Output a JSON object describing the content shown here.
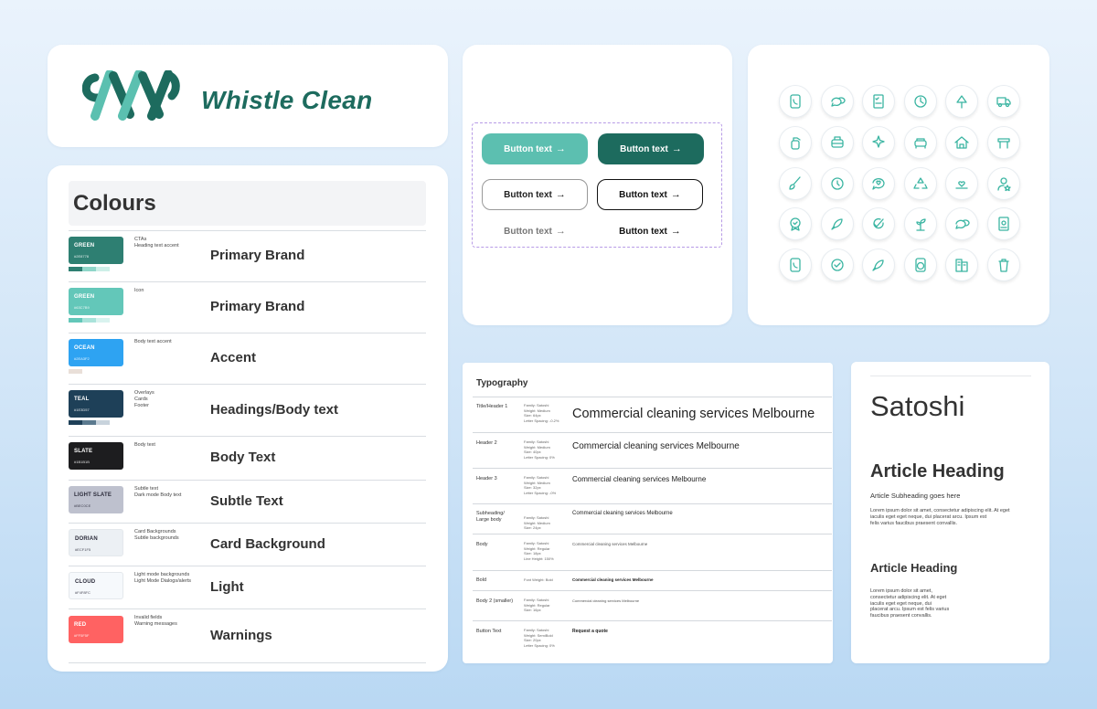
{
  "brand": {
    "name": "Whistle Clean",
    "logo_color": "#1d6b5e",
    "logo_color_light": "#5bc0b0"
  },
  "colours": {
    "title": "Colours",
    "rows": [
      {
        "name": "GREEN",
        "hex": "#2E8778",
        "usage": "CTAs\nHeading text accent",
        "label": "Primary Brand",
        "color": "#2e7f72",
        "text_color": "#ffffff",
        "tints": [
          "#2e7f72",
          "#8fd6c9",
          "#cdefe8"
        ]
      },
      {
        "name": "GREEN",
        "hex": "#63C7B9",
        "usage": "Icon",
        "label": "Primary Brand",
        "color": "#63c7b9",
        "text_color": "#ffffff",
        "tints": [
          "#63c7b9",
          "#a9e3da",
          "#d9f3ef"
        ]
      },
      {
        "name": "OCEAN",
        "hex": "#2EA3F2",
        "usage": "Body text accent",
        "label": "Accent",
        "color": "#2ea3f2",
        "text_color": "#ffffff",
        "tints": [
          "#e9dfd8",
          "#ffffff",
          "#ffffff"
        ]
      },
      {
        "name": "TEAL",
        "hex": "#1E3D57",
        "usage": "Overlays\nCards\nFooter",
        "label": "Headings/Body text",
        "color": "#1e4058",
        "text_color": "#ffffff",
        "tints": [
          "#1e4058",
          "#5b7a8f",
          "#c8d3dc"
        ]
      },
      {
        "name": "SLATE",
        "hex": "#1B1B1B",
        "usage": "Body text",
        "label": "Body Text",
        "color": "#1d1d1f",
        "text_color": "#ffffff",
        "tints": [
          "#ffffff",
          "#ffffff",
          "#ffffff"
        ]
      },
      {
        "name": "LIGHT SLATE",
        "hex": "#BEC0CE",
        "usage": "Subtle text\nDark mode Body text",
        "label": "Subtle Text",
        "color": "#bec1ce",
        "text_color": "#2b2b3a",
        "tints": [
          "#ffffff",
          "#ffffff",
          "#ffffff"
        ]
      },
      {
        "name": "DORIAN",
        "hex": "#ECF1F5",
        "usage": "Card Backgrounds\nSubtle backgrounds",
        "label": "Card Background",
        "color": "#ecf0f4",
        "text_color": "#2b2b3a",
        "tints": [
          "#ffffff",
          "#ffffff",
          "#ffffff"
        ]
      },
      {
        "name": "CLOUD",
        "hex": "#F4F8FC",
        "usage": "Light mode backgrounds\nLight Mode Dialogs/alerts",
        "label": "Light",
        "color": "#f6f9fc",
        "text_color": "#2b2b3a",
        "tints": [
          "#ffffff",
          "#ffffff",
          "#ffffff"
        ]
      },
      {
        "name": "RED",
        "hex": "#FF5F5F",
        "usage": "Invalid fields\nWarning messages",
        "label": "Warnings",
        "color": "#ff6262",
        "text_color": "#ffffff",
        "tints": [
          "#ffffff",
          "#ffffff",
          "#ffffff"
        ]
      }
    ]
  },
  "buttons": {
    "label": "Button text",
    "arrow": "→",
    "styles": [
      "filled-light",
      "filled-dark",
      "outline-soft",
      "outline-strong",
      "text-muted",
      "text-strong"
    ]
  },
  "icons": [
    "phone-book-icon",
    "chat-bubbles-icon",
    "checklist-icon",
    "clock-play-icon",
    "tree-icon",
    "delivery-truck-icon",
    "spray-bottle-icon",
    "armchair-box-icon",
    "sparkles-icon",
    "sofa-icon",
    "house-clean-icon",
    "table-icon",
    "broom-icon",
    "timer-icon",
    "chat-heart-icon",
    "recycle-icon",
    "heart-hand-icon",
    "user-star-icon",
    "badge-check-icon",
    "rocket-icon",
    "check-leaf-icon",
    "plant-growth-icon",
    "chat-bubbles-icon",
    "id-card-icon",
    "phone-book-icon",
    "check-circle-icon",
    "rocket-icon",
    "washing-machine-icon",
    "building-icon",
    "trash-icon"
  ],
  "typography": {
    "title": "Typography",
    "rows": [
      {
        "name": "Title/Header 1",
        "spec": "Family: Satoshi\nWeight: Medium\nSize: 64px\nLetter Spacing: -0.2%",
        "sample": "Commercial cleaning services Melbourne"
      },
      {
        "name": "Header 2",
        "spec": "Family: Satoshi\nWeight: Medium\nSize: 40px\nLetter Spacing: 0%",
        "sample": "Commercial cleaning services Melbourne"
      },
      {
        "name": "Header 3",
        "spec": "Family: Satoshi\nWeight: Medium\nSize: 32px\nLetter Spacing: -0%",
        "sample": "Commercial cleaning services Melbourne"
      },
      {
        "name": "Subheading/\nLarge body",
        "spec": "Family: Satoshi\nWeight: Medium\nSize: 24px",
        "sample": "Commercial cleaning services Melbourne"
      },
      {
        "name": "Body",
        "spec": "Family: Satoshi\nWeight: Regular\nSize: 18px\nLine Height: 150%",
        "sample": "Commercial cleaning services Melbourne"
      },
      {
        "name": "Bold",
        "spec": "Font Weight: Bold",
        "sample": "Commercial cleaning services Melbourne"
      },
      {
        "name": "Body 2 (smaller)",
        "spec": "Family: Satoshi\nWeight: Regular\nSize: 16px",
        "sample": "Commercial cleaning services Melbourne"
      },
      {
        "name": "Button Text",
        "spec": "Family: Satoshi\nWeight: SemiBold\nSize: 20px\nLetter Spacing: 0%",
        "sample": "Request a quote"
      }
    ]
  },
  "satoshi": {
    "font_name": "Satoshi",
    "article_heading": "Article Heading",
    "article_subheading": "Article Subheading goes here",
    "paragraph_1": "Lorem ipsum dolor sit amet, consectetur adipiscing elit. At eget\niaculis eget eget neque, dui placerat arcu. Ipsum est\nfelis varius faucibus praesent convallis.",
    "article_heading_2": "Article Heading",
    "paragraph_2": "Lorem ipsum dolor sit amet,\nconsectetur adipiscing elit. At eget\niaculis eget eget neque, dui\nplacerat arcu. Ipsum est felis varius\nfaucibus praesent convallis."
  }
}
